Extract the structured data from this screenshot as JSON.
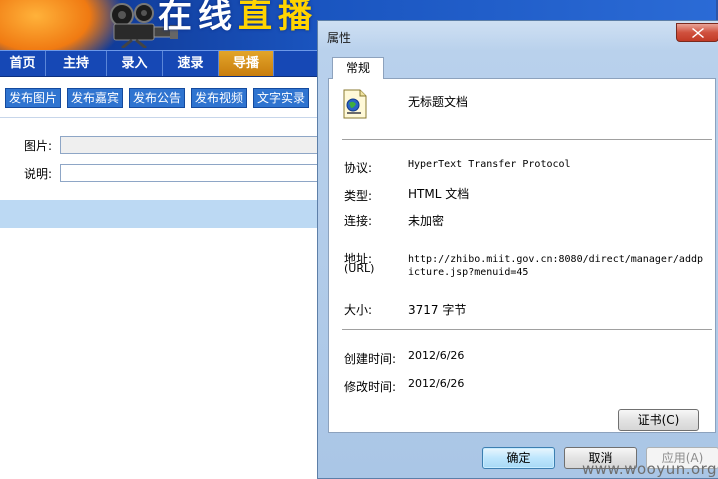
{
  "background_page": {
    "banner_title_part1": "在线",
    "banner_title_part2": "直播",
    "nav": [
      {
        "label": "首页"
      },
      {
        "label": "主持"
      },
      {
        "label": "录入"
      },
      {
        "label": "速录"
      },
      {
        "label": "导播",
        "active": true
      }
    ],
    "sub_buttons": [
      "发布图片",
      "发布嘉宾",
      "发布公告",
      "发布视频",
      "文字实录"
    ],
    "form": {
      "image_label": "图片:",
      "image_value": "",
      "desc_label": "说明:",
      "desc_value": ""
    }
  },
  "dialog": {
    "title": "属性",
    "tab": "常规",
    "file_icon": "html-document-icon",
    "file_name": "无标题文档",
    "protocol_label": "协议:",
    "protocol_value": "HyperText Transfer Protocol",
    "type_label": "类型:",
    "type_value": "HTML 文档",
    "connection_label": "连接:",
    "connection_value": "未加密",
    "address_label": "地址:",
    "address_label_sub": "(URL)",
    "address_value": "http://zhibo.miit.gov.cn:8080/direct/manager/addpicture.jsp?menuid=45",
    "size_label": "大小:",
    "size_value": "3717 字节",
    "created_label": "创建时间:",
    "created_value": "2012/6/26",
    "modified_label": "修改时间:",
    "modified_value": "2012/6/26",
    "cert_button": "证书(C)",
    "ok_button": "确定",
    "cancel_button": "取消",
    "apply_button": "应用(A)"
  },
  "watermark": "www.wooyun.org",
  "colors": {
    "nav_bg": "#1648b5",
    "nav_active": "#d38f18",
    "sub_button_bg": "#2f74d0",
    "dialog_frame": "#b9d1ec",
    "close_button": "#c94a36"
  }
}
